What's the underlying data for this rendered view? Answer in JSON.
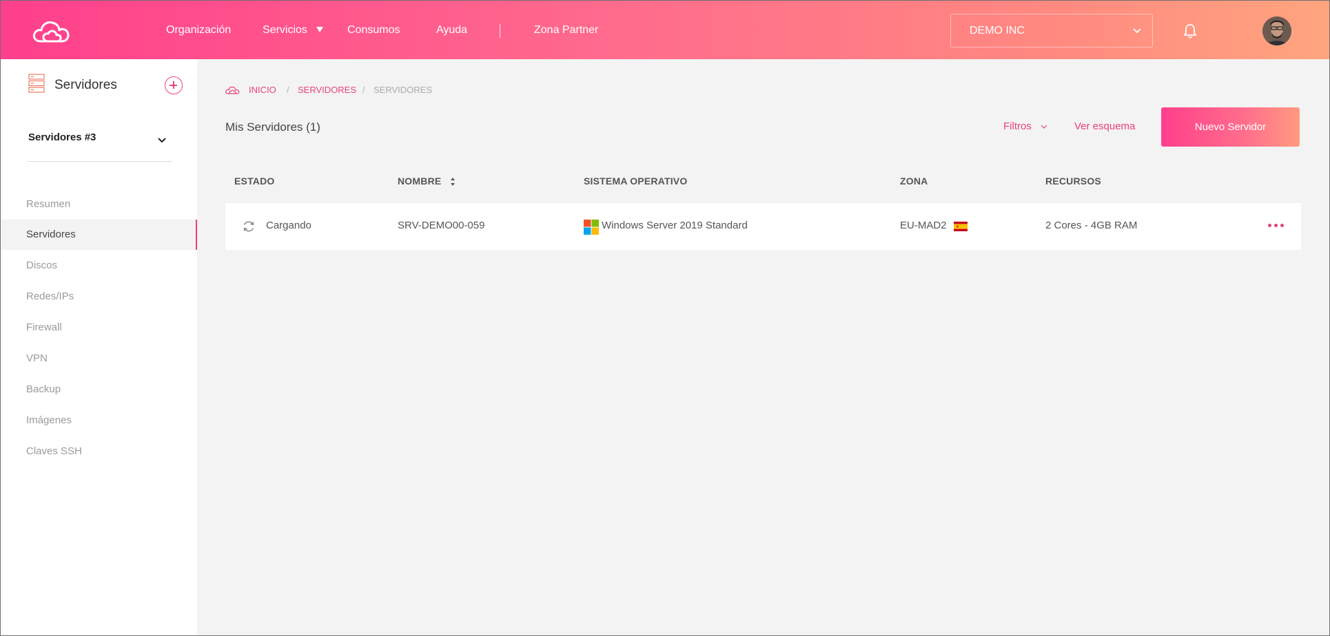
{
  "header": {
    "nav": {
      "organizacion": "Organización",
      "servicios": "Servicios",
      "consumos": "Consumos",
      "ayuda": "Ayuda",
      "zona_partner": "Zona Partner"
    },
    "org_selector": "DEMO INC"
  },
  "sidebar": {
    "title": "Servidores",
    "group": "Servidores #3",
    "items": [
      {
        "label": "Resumen"
      },
      {
        "label": "Servidores"
      },
      {
        "label": "Discos"
      },
      {
        "label": "Redes/IPs"
      },
      {
        "label": "Firewall"
      },
      {
        "label": "VPN"
      },
      {
        "label": "Backup"
      },
      {
        "label": "Imágenes"
      },
      {
        "label": "Claves SSH"
      }
    ]
  },
  "breadcrumb": {
    "home": "INICIO",
    "section": "SERVIDORES",
    "current": "SERVIDORES",
    "separator": "/"
  },
  "main": {
    "title": "Mis Servidores (1)",
    "filters": "Filtros",
    "view_schema": "Ver esquema",
    "new_server": "Nuevo Servidor"
  },
  "table": {
    "headers": {
      "estado": "ESTADO",
      "nombre": "NOMBRE",
      "sistema": "SISTEMA OPERATIVO",
      "zona": "ZONA",
      "recursos": "RECURSOS"
    },
    "rows": [
      {
        "estado": "Cargando",
        "nombre": "SRV-DEMO00-059",
        "sistema": "Windows Server 2019 Standard",
        "zona": "EU-MAD2",
        "recursos": "2 Cores - 4GB RAM"
      }
    ]
  },
  "colors": {
    "accent": "#e9417a",
    "header_gradient_start": "#ff3f8c",
    "header_gradient_end": "#ffa57f"
  }
}
